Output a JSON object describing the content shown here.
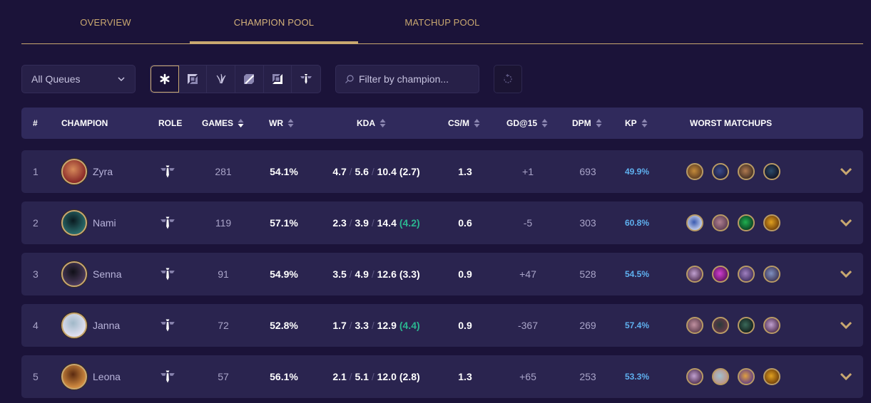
{
  "tabs": [
    {
      "label": "OVERVIEW",
      "active": false
    },
    {
      "label": "CHAMPION POOL",
      "active": true
    },
    {
      "label": "MATCHUP POOL",
      "active": false
    }
  ],
  "filters": {
    "queue": {
      "selected": "All Queues"
    },
    "roles": [
      {
        "name": "all-roles",
        "active": true
      },
      {
        "name": "top",
        "active": false
      },
      {
        "name": "jungle",
        "active": false
      },
      {
        "name": "mid",
        "active": false
      },
      {
        "name": "bot",
        "active": false
      },
      {
        "name": "support",
        "active": false
      }
    ],
    "search": {
      "placeholder": "Filter by champion...",
      "value": ""
    }
  },
  "colors": {
    "accent_gold": "#c9a870",
    "background": "#1b1339",
    "row_bg": "#2a244f",
    "header_bg": "#302a5c",
    "kda_good": "#2bb590",
    "kp_blue": "#5fb0ef"
  },
  "table": {
    "headers": {
      "rank": "#",
      "champion": "CHAMPION",
      "role": "ROLE",
      "games": "GAMES",
      "wr": "WR",
      "kda": "KDA",
      "csm": "CS/M",
      "gd15": "GD@15",
      "dpm": "DPM",
      "kp": "KP",
      "worst": "WORST MATCHUPS"
    },
    "sorted_by": "games",
    "rows": [
      {
        "rank": "1",
        "champion": "Zyra",
        "role": "support",
        "games": "281",
        "wr": "54.1%",
        "k": "4.7",
        "d": "5.6",
        "a": "10.4",
        "ratio": "(2.7)",
        "ratio_good": false,
        "csm": "1.3",
        "gd15": "+1",
        "dpm": "693",
        "kp": "49.9%",
        "avatar_colors": [
          "#8a2a28",
          "#d68a5a"
        ],
        "worst": [
          [
            "#c48a3a",
            "#5a3a20"
          ],
          [
            "#3a4a8a",
            "#1a1a3a"
          ],
          [
            "#b07a50",
            "#3a2a20"
          ],
          [
            "#2a4a6a",
            "#101020"
          ]
        ]
      },
      {
        "rank": "2",
        "champion": "Nami",
        "role": "support",
        "games": "119",
        "wr": "57.1%",
        "k": "2.3",
        "d": "3.9",
        "a": "14.4",
        "ratio": "(4.2)",
        "ratio_good": true,
        "csm": "0.6",
        "gd15": "-5",
        "dpm": "303",
        "kp": "60.8%",
        "avatar_colors": [
          "#2a6a6a",
          "#0a1a20"
        ],
        "worst": [
          [
            "#3a5ab0",
            "#d0d8f0"
          ],
          [
            "#b08090",
            "#5a3a50"
          ],
          [
            "#20b050",
            "#0a3a20"
          ],
          [
            "#e0a020",
            "#6a3a08"
          ]
        ]
      },
      {
        "rank": "3",
        "champion": "Senna",
        "role": "support",
        "games": "91",
        "wr": "54.9%",
        "k": "3.5",
        "d": "4.9",
        "a": "12.6",
        "ratio": "(3.3)",
        "ratio_good": false,
        "csm": "0.9",
        "gd15": "+47",
        "dpm": "528",
        "kp": "54.5%",
        "avatar_colors": [
          "#4a3a5a",
          "#101018"
        ],
        "worst": [
          [
            "#c0a0d0",
            "#4a2a4a"
          ],
          [
            "#d040d0",
            "#5a105a"
          ],
          [
            "#a080c0",
            "#3a2a5a"
          ],
          [
            "#8090c0",
            "#3a3050"
          ]
        ]
      },
      {
        "rank": "4",
        "champion": "Janna",
        "role": "support",
        "games": "72",
        "wr": "52.8%",
        "k": "1.7",
        "d": "3.3",
        "a": "12.9",
        "ratio": "(4.4)",
        "ratio_good": true,
        "csm": "0.9",
        "gd15": "-367",
        "dpm": "269",
        "kp": "57.4%",
        "avatar_colors": [
          "#e0e0f0",
          "#a0b8c8"
        ],
        "worst": [
          [
            "#c090a0",
            "#5a3a4a"
          ],
          [
            "#2a3a3a",
            "#6a3a4a"
          ],
          [
            "#3a6a5a",
            "#101a18"
          ],
          [
            "#c0a0d0",
            "#4a2a4a"
          ]
        ]
      },
      {
        "rank": "5",
        "champion": "Leona",
        "role": "support",
        "games": "57",
        "wr": "56.1%",
        "k": "2.1",
        "d": "5.1",
        "a": "12.0",
        "ratio": "(2.8)",
        "ratio_good": false,
        "csm": "1.3",
        "gd15": "+65",
        "dpm": "253",
        "kp": "53.3%",
        "avatar_colors": [
          "#d08a40",
          "#5a2a10"
        ],
        "worst": [
          [
            "#c0a0d0",
            "#4a2a4a"
          ],
          [
            "#a0c0d0",
            "#c09080"
          ],
          [
            "#e0a040",
            "#5a3a8a"
          ],
          [
            "#e0a020",
            "#6a3a08"
          ]
        ]
      }
    ]
  }
}
